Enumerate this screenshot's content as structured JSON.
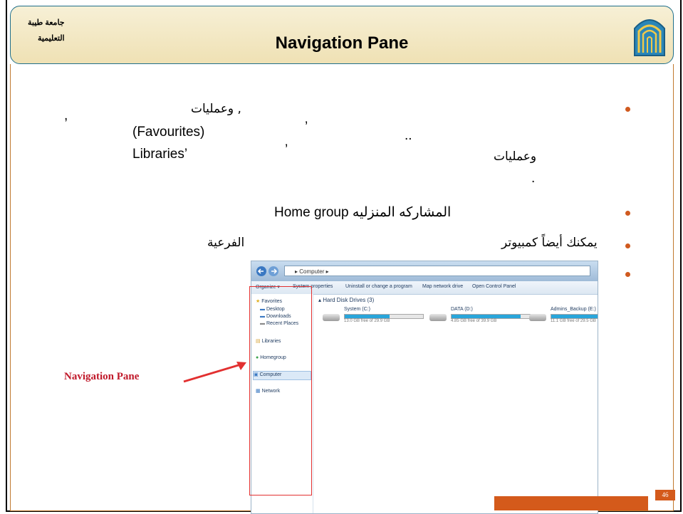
{
  "slide": {
    "title": "Navigation Pane",
    "university_line1": "جامعة طيبة",
    "university_line2": "التعليمية",
    "page_number": "46",
    "footer_number": "46"
  },
  "bullets": {
    "b1_word1": "وعمليات ,",
    "b1_comma": ",",
    "b1_favourites": "(Favourites)",
    "b1_apos1": "’",
    "b1_dots": "..",
    "b1_libraries": "Libraries’",
    "b1_apos2": "’",
    "b1_word2": "وعمليات",
    "b1_end": ".",
    "b2_text": "Home group المشاركه المنزليه",
    "b3_word1": "يمكنك أيضاً كمبيوتر",
    "b3_word2": "الفرعية"
  },
  "window": {
    "address": "▸ Computer ▸",
    "toolbar": [
      "Organize ▾",
      "System properties",
      "Uninstall or change a program",
      "Map network drive",
      "Open Control Panel"
    ],
    "nav": {
      "favorites": "Favorites",
      "desktop": "Desktop",
      "downloads": "Downloads",
      "recent": "Recent Places",
      "libraries": "Libraries",
      "homegroup": "Homegroup",
      "computer": "Computer",
      "network": "Network"
    },
    "section_header": "▴ Hard Disk Drives (3)",
    "drives": [
      {
        "name": "System (C:)",
        "free": "13.0 GB free of 29.9 GB",
        "used_fraction": 0.57
      },
      {
        "name": "DATA (D:)",
        "free": "4.85 GB free of 39.9 GB",
        "used_fraction": 0.88
      },
      {
        "name": "Admins_Backup (E:)",
        "free": "11.1 GB free of 29.5 GB",
        "used_fraction": 0.62
      }
    ]
  },
  "annotation": {
    "label": "Navigation Pane",
    "arrow_color": "#e23030"
  },
  "colors": {
    "accent": "#d45a1b",
    "header_border": "#1f6f8b",
    "label_red": "#c0192a"
  }
}
